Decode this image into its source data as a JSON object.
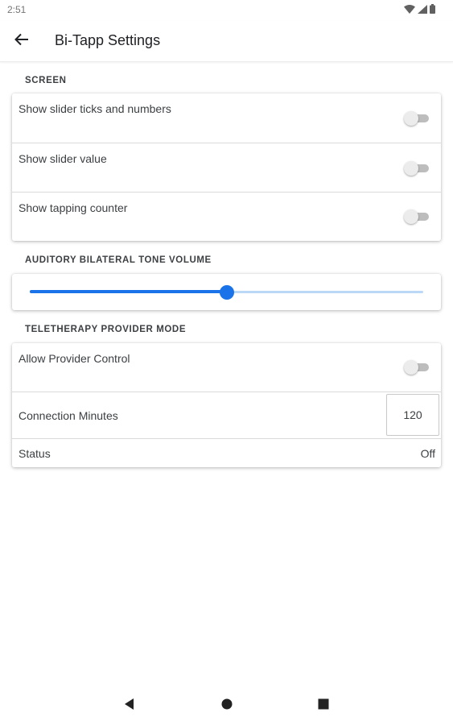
{
  "status_bar": {
    "time": "2:51",
    "icons": [
      "wifi-icon",
      "signal-icon",
      "battery-icon"
    ]
  },
  "appbar": {
    "title": "Bi-Tapp Settings",
    "back_icon": "arrow-back-icon"
  },
  "sections": {
    "screen": {
      "header": "SCREEN",
      "items": [
        {
          "label": "Show slider ticks and numbers",
          "enabled": false
        },
        {
          "label": "Show slider value",
          "enabled": false
        },
        {
          "label": "Show tapping counter",
          "enabled": false
        }
      ]
    },
    "volume": {
      "header": "AUDITORY BILATERAL TONE VOLUME",
      "level_fraction": 0.5
    },
    "teletherapy": {
      "header": "TELETHERAPY PROVIDER MODE",
      "allow_label": "Allow Provider Control",
      "allow_enabled": false,
      "minutes_label": "Connection Minutes",
      "minutes_value": "120",
      "status_label": "Status",
      "status_value": "Off"
    }
  },
  "nav": {
    "icons": [
      "back-triangle-icon",
      "home-circle-icon",
      "recents-square-icon"
    ]
  },
  "colors": {
    "accent": "#1a73e8",
    "accent_light": "#bcd8f7",
    "switch_off_track": "#bdbdbd",
    "switch_off_thumb": "#ececec"
  }
}
